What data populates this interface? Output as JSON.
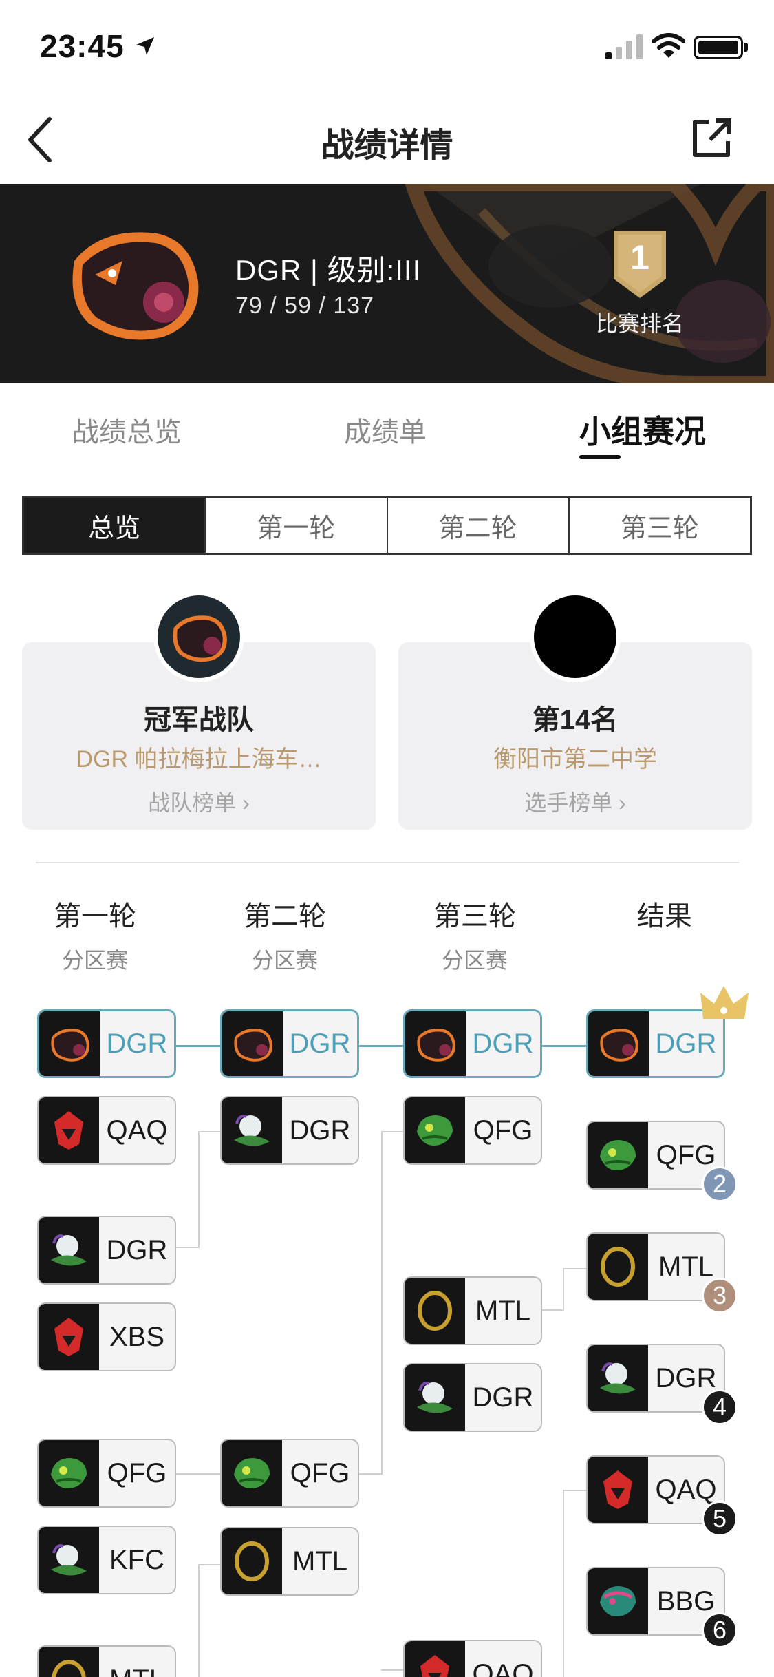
{
  "status": {
    "time": "23:45"
  },
  "nav": {
    "title": "战绩详情"
  },
  "banner": {
    "title": "DGR | 级别:III",
    "stats": "79 / 59 / 137",
    "rank": "1",
    "rank_label": "比赛排名"
  },
  "tabs": [
    "战绩总览",
    "成绩单",
    "小组赛况"
  ],
  "active_tab": 2,
  "segments": [
    "总览",
    "第一轮",
    "第二轮",
    "第三轮"
  ],
  "active_segment": 0,
  "cards": [
    {
      "title": "冠军战队",
      "subtitle": "DGR 帕拉梅拉上海车…",
      "link": "战队榜单 ›"
    },
    {
      "title": "第14名",
      "subtitle": "衡阳市第二中学",
      "link": "选手榜单 ›"
    }
  ],
  "columns": [
    {
      "title": "第一轮",
      "subtitle": "分区赛"
    },
    {
      "title": "第二轮",
      "subtitle": "分区赛"
    },
    {
      "title": "第三轮",
      "subtitle": "分区赛"
    },
    {
      "title": "结果",
      "subtitle": ""
    }
  ],
  "bracket": {
    "round1": [
      "DGR",
      "QAQ",
      "DGR",
      "XBS",
      "QFG",
      "KFC",
      "MTL"
    ],
    "round2": [
      "DGR",
      "DGR",
      "QFG",
      "MTL"
    ],
    "round3": [
      "DGR",
      "QFG",
      "MTL",
      "DGR",
      "QAQ"
    ],
    "results": [
      {
        "name": "DGR",
        "rank": ""
      },
      {
        "name": "QFG",
        "rank": "2"
      },
      {
        "name": "MTL",
        "rank": "3"
      },
      {
        "name": "DGR",
        "rank": "4"
      },
      {
        "name": "QAQ",
        "rank": "5"
      },
      {
        "name": "BBG",
        "rank": "6"
      }
    ]
  },
  "colors": {
    "accent": "#6aa8ba",
    "gold": "#b99a6e",
    "silver": "#7f97b5",
    "bronze": "#b08e7c",
    "dark": "#1b1b1b"
  },
  "icons": [
    "location-arrow-icon",
    "signal-icon",
    "wifi-icon",
    "battery-icon",
    "back-chevron-icon",
    "share-icon",
    "crown-icon"
  ]
}
